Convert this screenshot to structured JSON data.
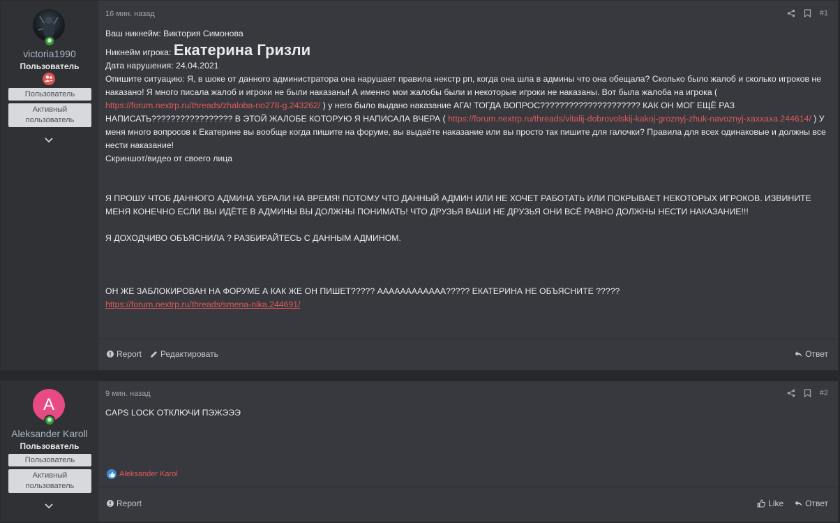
{
  "posts": [
    {
      "user": {
        "name": "victoria1990",
        "title": "Пользователь",
        "banners": [
          "Пользователь",
          "Активный пользователь"
        ]
      },
      "time": "16 мин. назад",
      "number": "#1",
      "content": {
        "line1": "Ваш никнейм: Виктория Симонова",
        "line2_label": "Никнейм игрока: ",
        "line2_value": "Екатерина Гризли",
        "line3": "Дата нарушения: 24.04.2021",
        "para_a": "Опишите ситуацию: Я, в шоке от данного администратора она нарушает правила некстр рп, когда она шла в админы что она обещала? Сколько было жалоб и сколько игроков не наказано! Я много писала жалоб и игроки не были наказаны! А именно мои жалобы были и некоторые игроки не наказаны. Вот была жалоба на игрока ( ",
        "link1": "https://forum.nextrp.ru/threads/zhaloba-no278-g.243262/",
        "para_b": " ) у него было выдано наказание АГА! ТОГДА ВОПРОС????????????????????? КАК ОН МОГ ЕЩЁ РАЗ НАПИСАТЬ????????????????? В ЭТОЙ ЖАЛОБЕ КОТОРУЮ Я НАПИСАЛА ВЧЕРА ( ",
        "link2": "https://forum.nextrp.ru/threads/vitalij-dobrovolskij-kakoj-groznyj-zhuk-navoznyj-xaxxaxa.244614/",
        "para_c": " ) У меня много вопросов к Екатерине вы вообще когда пишите на форуме, вы выдаёте наказание или вы просто так пишите для галочки? Правила для всех одинаковые и должны все нести наказание!",
        "line_screenshot": "Скриншот/видео от своего лица",
        "caps1": "Я ПРОШУ ЧТОБ ДАННОГО АДМИНА УБРАЛИ НА ВРЕМЯ! ПОТОМУ ЧТО ДАННЫЙ АДМИН ИЛИ НЕ ХОЧЕТ РАБОТАТЬ ИЛИ ПОКРЫВАЕТ НЕКОТОРЫХ ИГРОКОВ. ИЗВИНИТЕ МЕНЯ КОНЕЧНО ЕСЛИ ВЫ ИДЁТЕ В АДМИНЫ ВЫ ДОЛЖНЫ ПОНИМАТЬ! ЧТО ДРУЗЬЯ ВАШИ НЕ ДРУЗЬЯ ОНИ ВСЁ РАВНО ДОЛЖНЫ НЕСТИ НАКАЗАНИЕ!!!",
        "caps2": "Я ДОХОДЧИВО ОБЪЯСНИЛА ? РАЗБИРАЙТЕСЬ С ДАННЫМ АДМИНОМ.",
        "caps3": "ОН ЖЕ ЗАБЛОКИРОВАН НА ФОРУМЕ А КАК ЖЕ ОН ПИШЕТ????? АААААААААААА????? ЕКАТЕРИНА НЕ ОБЪЯСНИТЕ ?????",
        "link3": "https://forum.nextrp.ru/threads/smena-nika.244691/"
      },
      "actions": {
        "report": "Report",
        "edit": "Редактировать",
        "reply": "Ответ"
      }
    },
    {
      "user": {
        "avatar_letter": "A",
        "name": "Aleksander Karoll",
        "title": "Пользователь",
        "banners": [
          "Пользователь",
          "Активный пользователь"
        ]
      },
      "time": "9 мин. назад",
      "number": "#2",
      "content": {
        "text": "CAPS LOCK ОТКЛЮЧИ ПЭЖЭЭЭ"
      },
      "reaction_user": "Aleksander Karol",
      "actions": {
        "report": "Report",
        "like": "Like",
        "reply": "Ответ"
      }
    }
  ],
  "colors": {
    "link": "#e05a5a",
    "username": "#a8b6c6",
    "avatar_pink": "#e74a84",
    "online": "#3d9a3d"
  }
}
